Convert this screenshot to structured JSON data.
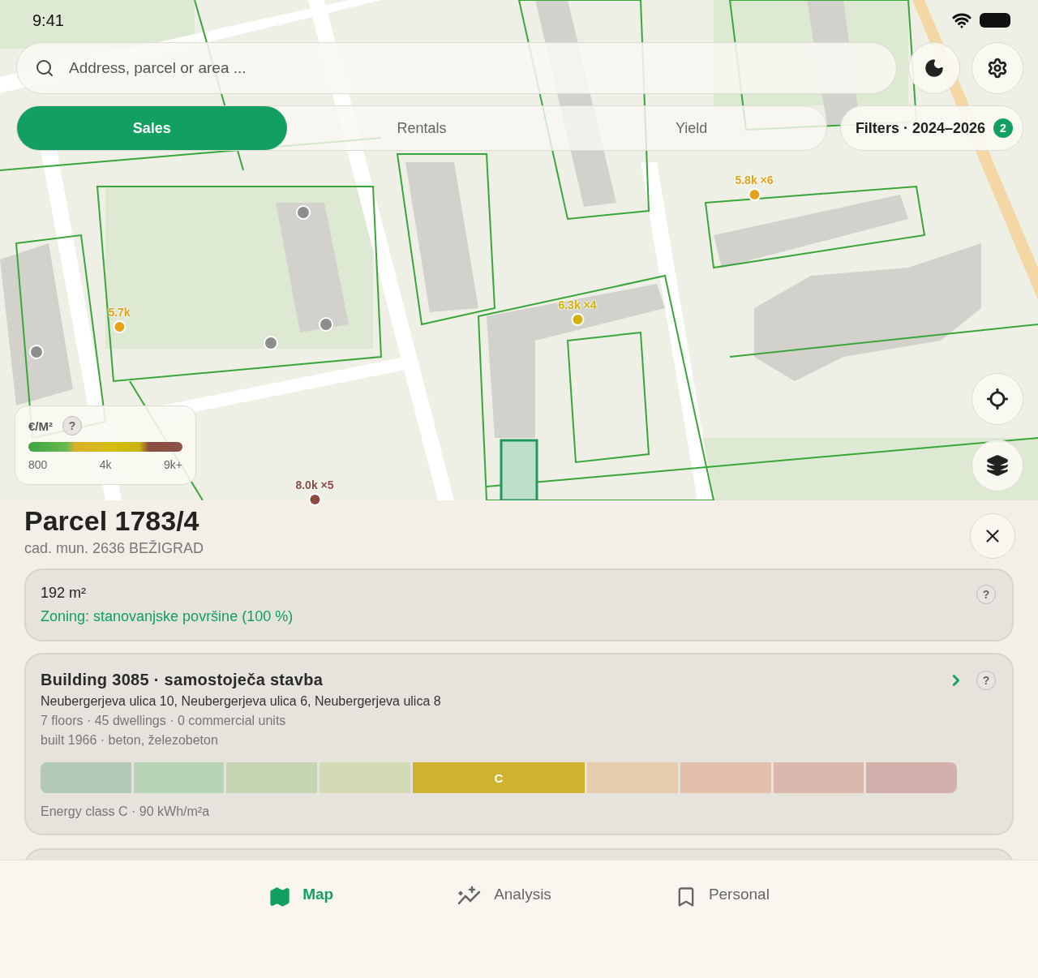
{
  "status_bar": {
    "time": "9:41"
  },
  "search": {
    "placeholder": "Address, parcel or area ..."
  },
  "modes": [
    {
      "label": "Sales",
      "selected": true
    },
    {
      "label": "Rentals",
      "selected": false
    },
    {
      "label": "Yield",
      "selected": false
    }
  ],
  "filters": {
    "label": "Filters · 2024–2026",
    "count": "2"
  },
  "map_markers": [
    {
      "label": "5.8k ×6",
      "color": "#e3a21a"
    },
    {
      "label": "5.7k",
      "color": "#e3a21a"
    },
    {
      "label": "6.3k ×4",
      "color": "#d4b106"
    },
    {
      "label": "8.0k ×5",
      "color": "#8a4a3c"
    }
  ],
  "legend": {
    "title": "€/M²",
    "help": "?",
    "ticks": [
      "800",
      "4k",
      "9k+"
    ]
  },
  "parcel": {
    "title": "Parcel 1783/4",
    "subtitle": "cad. mun. 2636 BEŽIGRAD"
  },
  "area_card": {
    "area": "192 m²",
    "zoning": "Zoning: stanovanjske površine (100 %)",
    "help": "?"
  },
  "building_card": {
    "title": "Building 3085 · samostoječa stavba",
    "help": "?",
    "address": "Neubergerjeva ulica 10, Neubergerjeva ulica 6, Neubergerjeva ulica 8",
    "details": [
      "7 floors · 45 dwellings · 0 commercial units",
      "built 1966 · beton, železobeton"
    ],
    "energy_segments": [
      {
        "color": "#b3c9b6",
        "selected": false
      },
      {
        "color": "#b8d4b8",
        "selected": false
      },
      {
        "color": "#c6d4b4",
        "selected": false
      },
      {
        "color": "#d3dab4",
        "selected": false
      },
      {
        "color": "#d1b22e",
        "selected": true,
        "label": "C"
      },
      {
        "color": "#e6ccac",
        "selected": false
      },
      {
        "color": "#e3c0ab",
        "selected": false
      },
      {
        "color": "#dbb8ad",
        "selected": false
      },
      {
        "color": "#d2b1ad",
        "selected": false
      }
    ],
    "energy_caption": "Energy class C · 90 kWh/m²a"
  },
  "nav": [
    {
      "label": "Map",
      "kind": "map",
      "selected": true
    },
    {
      "label": "Analysis",
      "kind": "analysis",
      "selected": false
    },
    {
      "label": "Personal",
      "kind": "bookmark",
      "selected": false
    }
  ]
}
